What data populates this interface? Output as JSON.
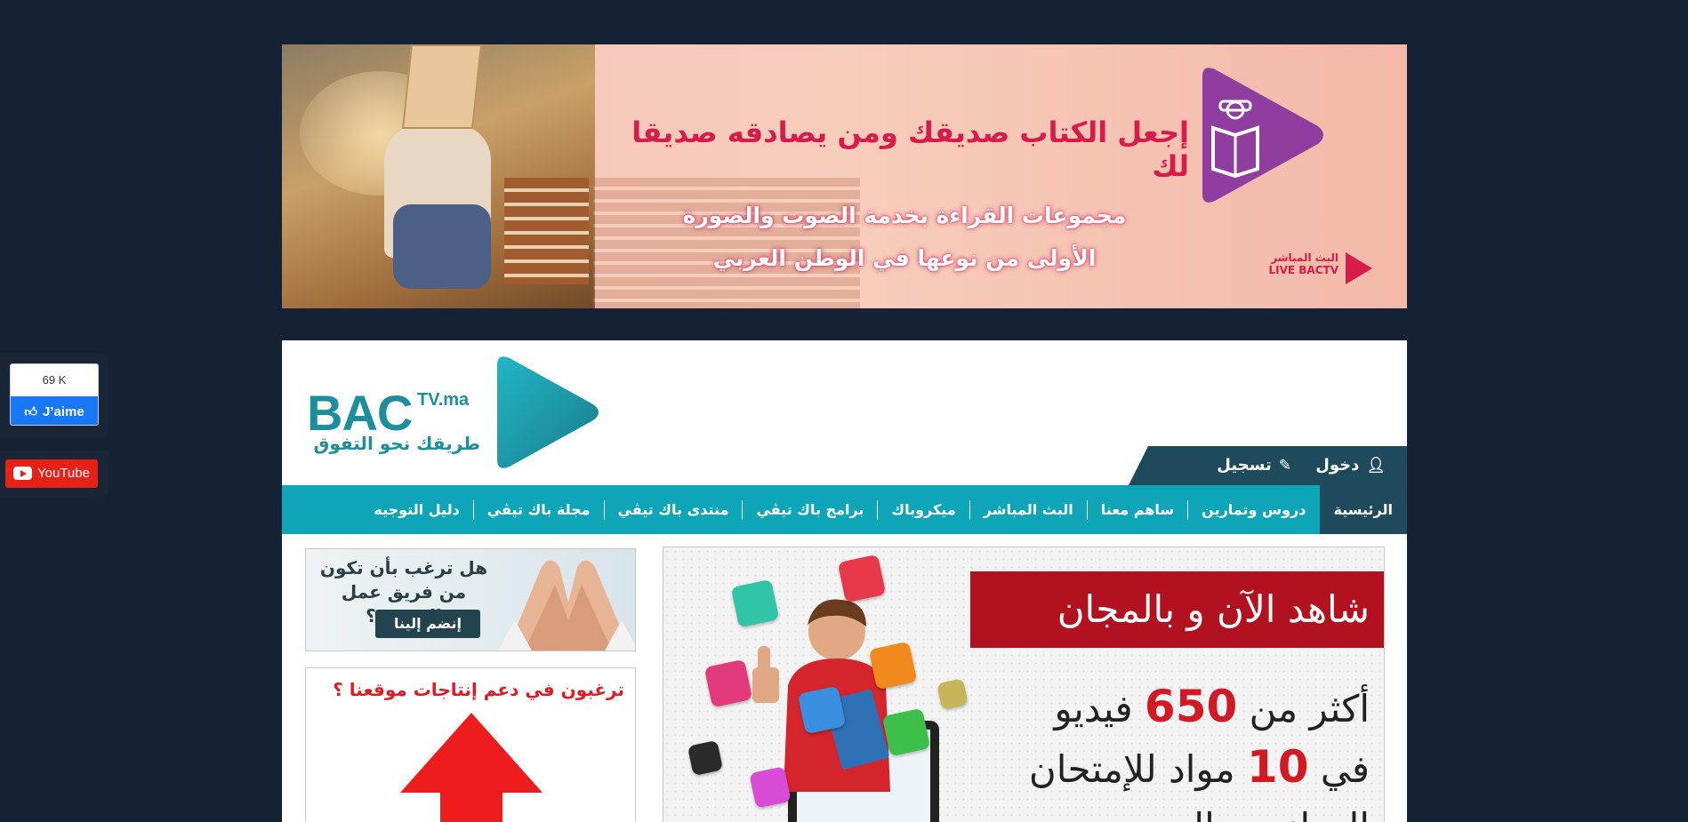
{
  "social": {
    "facebook": {
      "count": "69 K",
      "like_label": "J’aime"
    },
    "youtube": {
      "label": "YouTube"
    }
  },
  "top_banner": {
    "headline": "إجعل الكتاب صديقك ومن يصادقه صديقا لك",
    "line1": "مجموعات القراءة بخدمة الصوت والصورة",
    "line2": "الأولى من نوعها في الوطن العربي",
    "live_line1": "البث المباشر",
    "live_line2": "LIVE BACTV"
  },
  "logo": {
    "brand": "BAC",
    "domain": "TV.ma",
    "tagline": "طريقك نحو التفوق"
  },
  "account": {
    "login": "دخول",
    "register": "تسجيل"
  },
  "nav": {
    "items": [
      {
        "label": "الرئيسية",
        "active": true
      },
      {
        "label": "دروس وتمارين"
      },
      {
        "label": "ساهم معنا"
      },
      {
        "label": "البث المباشر"
      },
      {
        "label": "ميكروباك"
      },
      {
        "label": "برامج باك تيڤي"
      },
      {
        "label": "منتدى باك تيڤي"
      },
      {
        "label": "مجلة باك تيڤي"
      },
      {
        "label": "دليل التوجيه"
      }
    ]
  },
  "promo": {
    "banner": "شاهد الآن و بالمجان",
    "line1_prefix": "أكثر من",
    "line1_number": "650",
    "line1_suffix": "فيديو",
    "line2_prefix": "في",
    "line2_number": "10",
    "line2_suffix": "مواد للإمتحان",
    "line3": "الوطني و الجهوي"
  },
  "sidebar": {
    "ad1_line1": "هل ترغب بأن تكون",
    "ad1_line2": "من فريق عمل الموقع ؟",
    "ad1_button": "إنضم إلينا",
    "ad2_text": "ترغبون في دعم إنتاجات موقعنا ؟"
  },
  "colors": {
    "page_bg": "#152135",
    "nav_bg": "#0fa5b9",
    "nav_active": "#1f4a5c",
    "brand_teal": "#1f8e9c",
    "banner_headline": "#d81b4a",
    "promo_red": "#b2111f"
  }
}
